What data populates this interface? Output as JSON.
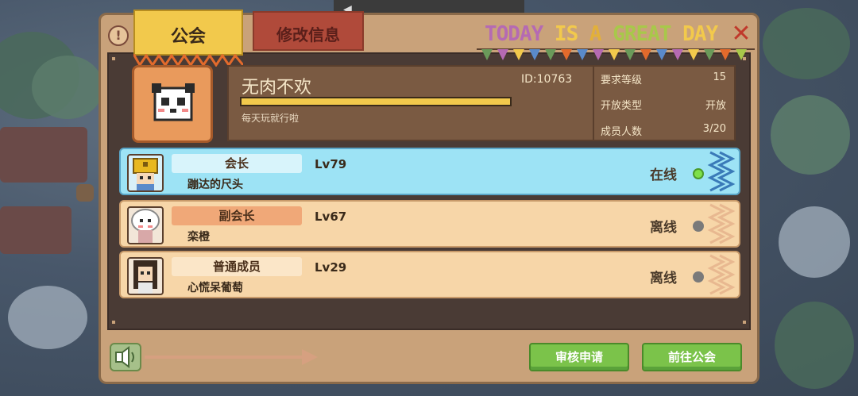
{
  "tabs": {
    "guild": "公会",
    "edit": "修改信息"
  },
  "banner": {
    "words": [
      {
        "text": "TODAY",
        "color": "#b56ab3"
      },
      {
        "text": " IS ",
        "color": "#f2c94c"
      },
      {
        "text": "A ",
        "color": "#e2b03a"
      },
      {
        "text": "GREAT",
        "color": "#a8c84a"
      },
      {
        "text": " DAY",
        "color": "#f2c94c"
      }
    ]
  },
  "guild": {
    "name": "无肉不欢",
    "id": "ID:10763",
    "motto": "每天玩就行啦",
    "progress": 1.0,
    "avatar": "panda-icon"
  },
  "stats": [
    {
      "key": "要求等级",
      "value": "15"
    },
    {
      "key": "开放类型",
      "value": "开放"
    },
    {
      "key": "成员人数",
      "value": "3/20"
    }
  ],
  "members": [
    {
      "role": "会长",
      "level": "Lv79",
      "name": "蹦达的尺头",
      "status": "在线",
      "online": true,
      "avatar": "gold-helmet-avatar-icon"
    },
    {
      "role": "副会长",
      "level": "Lv67",
      "name": "栾橙",
      "status": "离线",
      "online": false,
      "avatar": "white-hood-avatar-icon"
    },
    {
      "role": "普通成员",
      "level": "Lv29",
      "name": "心慌呆葡萄",
      "status": "离线",
      "online": false,
      "avatar": "dark-hair-avatar-icon"
    }
  ],
  "buttons": {
    "review": "审核申请",
    "goto": "前往公会"
  },
  "colors": {
    "panel": "#c9a27a",
    "online_row": "#9de3f5",
    "offline_row": "#f7d6a8",
    "online_dot": "#7ee04a",
    "offline_dot": "#7a7a7a",
    "button": "#7bc34a"
  }
}
